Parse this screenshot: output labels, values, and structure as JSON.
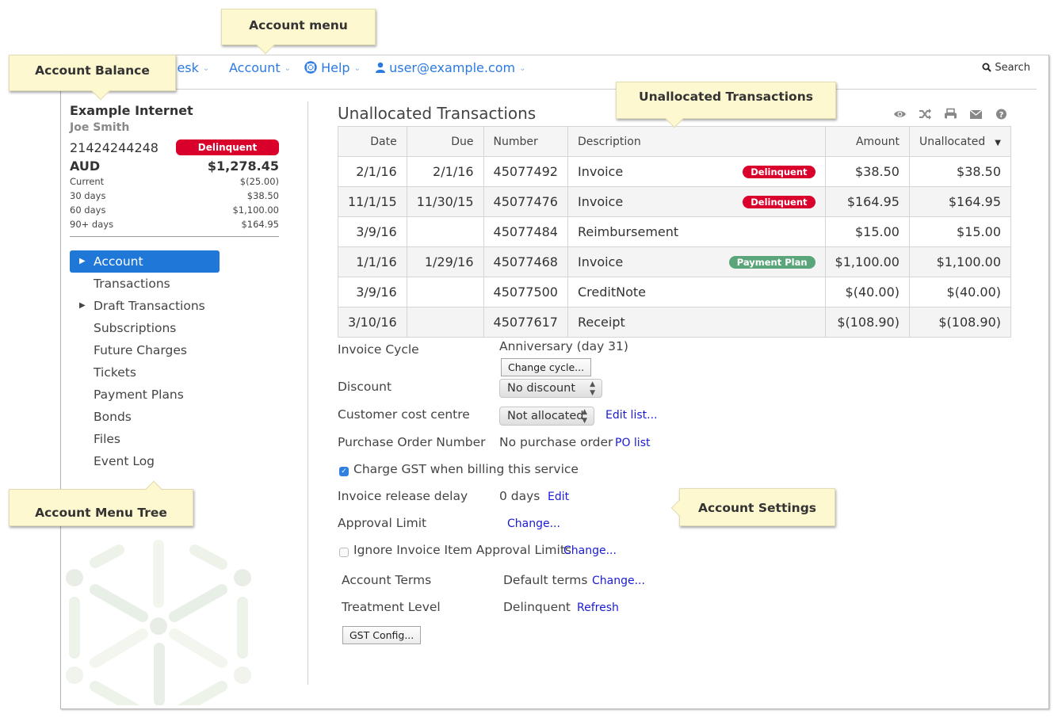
{
  "nav": {
    "items": [
      {
        "label": "lesk",
        "icon": "none"
      },
      {
        "label": "Account",
        "icon": "none"
      },
      {
        "label": "Help",
        "icon": "lifebuoy-icon"
      },
      {
        "label": "user@example.com",
        "icon": "user-icon"
      }
    ],
    "search_label": "Search"
  },
  "account": {
    "name": "Example Internet",
    "contact": "Joe Smith",
    "number": "21424244248",
    "status": "Delinquent",
    "currency": "AUD",
    "balance": "$1,278.45",
    "aging": [
      {
        "label": "Current",
        "value": "$(25.00)"
      },
      {
        "label": "30 days",
        "value": "$38.50"
      },
      {
        "label": "60 days",
        "value": "$1,100.00"
      },
      {
        "label": "90+ days",
        "value": "$164.95"
      }
    ]
  },
  "tree": {
    "items": [
      {
        "label": "Account",
        "active": true,
        "expandable": true
      },
      {
        "label": "Transactions"
      },
      {
        "label": "Draft Transactions",
        "expandable": true
      },
      {
        "label": "Subscriptions"
      },
      {
        "label": "Future Charges"
      },
      {
        "label": "Tickets"
      },
      {
        "label": "Payment Plans"
      },
      {
        "label": "Bonds"
      },
      {
        "label": "Files"
      },
      {
        "label": "Event Log"
      }
    ]
  },
  "main": {
    "title": "Unallocated Transactions",
    "tools": [
      "eye-icon",
      "shuffle-icon",
      "print-icon",
      "envelope-icon",
      "help-icon"
    ],
    "columns": [
      "Date",
      "Due",
      "Number",
      "Description",
      "Amount",
      "Unallocated"
    ],
    "rows": [
      {
        "date": "2/1/16",
        "due": "2/1/16",
        "number": "45077492",
        "description": "Invoice",
        "badge": "Delinquent",
        "badge_color": "#d9002c",
        "amount": "$38.50",
        "unallocated": "$38.50"
      },
      {
        "date": "11/1/15",
        "due": "11/30/15",
        "number": "45077476",
        "description": "Invoice",
        "badge": "Delinquent",
        "badge_color": "#d9002c",
        "amount": "$164.95",
        "unallocated": "$164.95"
      },
      {
        "date": "3/9/16",
        "due": "",
        "number": "45077484",
        "description": "Reimbursement",
        "badge": "",
        "amount": "$15.00",
        "unallocated": "$15.00"
      },
      {
        "date": "1/1/16",
        "due": "1/29/16",
        "number": "45077468",
        "description": "Invoice",
        "badge": "Payment Plan",
        "badge_color": "#5aa67a",
        "amount": "$1,100.00",
        "unallocated": "$1,100.00"
      },
      {
        "date": "3/9/16",
        "due": "",
        "number": "45077500",
        "description": "CreditNote",
        "badge": "",
        "amount": "$(40.00)",
        "unallocated": "$(40.00)"
      },
      {
        "date": "3/10/16",
        "due": "",
        "number": "45077617",
        "description": "Receipt",
        "badge": "",
        "amount": "$(108.90)",
        "unallocated": "$(108.90)"
      }
    ]
  },
  "settings": {
    "invoice_cycle": {
      "label": "Invoice Cycle",
      "value": "Anniversary (day 31)",
      "button": "Change cycle..."
    },
    "discount": {
      "label": "Discount",
      "selected": "No discount"
    },
    "cost_centre": {
      "label": "Customer cost centre",
      "selected": "Not allocated",
      "link": "Edit list..."
    },
    "po": {
      "label": "Purchase Order Number",
      "value": "No purchase order",
      "link": "PO list"
    },
    "gst": {
      "label": "Charge GST when billing this service",
      "checked": true
    },
    "release_delay": {
      "label": "Invoice release delay",
      "value": "0 days",
      "link": "Edit"
    },
    "approval_limit": {
      "label": "Approval Limit",
      "link": "Change..."
    },
    "ignore_limits": {
      "label": "Ignore Invoice Item Approval Limits",
      "checked": false,
      "link": "Change..."
    },
    "terms": {
      "label": "Account Terms",
      "value": "Default terms",
      "link": "Change..."
    },
    "treatment": {
      "label": "Treatment Level",
      "value": "Delinquent",
      "link": "Refresh"
    },
    "gst_config_button": "GST Config..."
  },
  "callouts": {
    "account_menu": "Account menu",
    "account_balance": "Account Balance",
    "unallocated": "Unallocated Transactions",
    "menu_tree": "Account Menu Tree",
    "settings": "Account Settings"
  },
  "colors": {
    "accent": "#1f78d8",
    "link": "#2a7ae2",
    "delinquent": "#d9002c",
    "payment_plan": "#5aa67a",
    "callout": "#fdf8cf"
  }
}
